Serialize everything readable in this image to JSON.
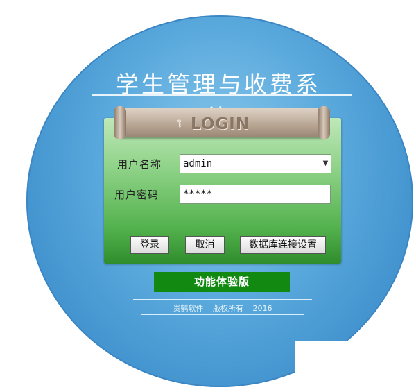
{
  "app": {
    "title": "学生管理与收费系统"
  },
  "login_banner": {
    "text": "LOGIN",
    "icon": "login-person-icon"
  },
  "form": {
    "username_label": "用户名称",
    "username_value": "admin",
    "password_label": "用户密码",
    "password_value": "*****"
  },
  "buttons": {
    "login": "登录",
    "cancel": "取消",
    "db_settings": "数据库连接设置"
  },
  "edition": "功能体验版",
  "footer": {
    "text": "贵鹤软件   版权所有   2016"
  },
  "colors": {
    "circle": "#58a8dc",
    "panel_green": "#54b24e",
    "edition_bg": "#128a12",
    "banner": "#b6a491"
  }
}
